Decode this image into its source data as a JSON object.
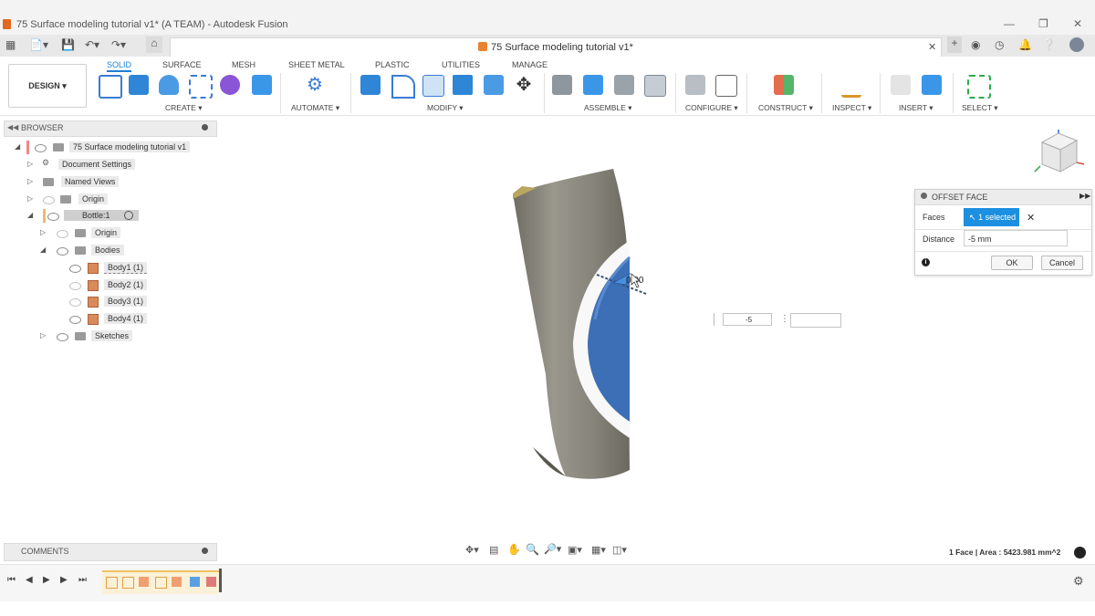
{
  "window": {
    "title": "75 Surface modeling tutorial v1* (A TEAM) - Autodesk Fusion"
  },
  "tab": {
    "doc_title": "75 Surface modeling tutorial v1*"
  },
  "workspace": {
    "label": "DESIGN"
  },
  "ribbon": {
    "tabs": [
      "SOLID",
      "SURFACE",
      "MESH",
      "SHEET METAL",
      "PLASTIC",
      "UTILITIES",
      "MANAGE"
    ],
    "active_tab": "SOLID",
    "groups": [
      "CREATE",
      "AUTOMATE",
      "MODIFY",
      "ASSEMBLE",
      "CONFIGURE",
      "CONSTRUCT",
      "INSPECT",
      "INSERT",
      "SELECT"
    ]
  },
  "browser": {
    "title": "BROWSER",
    "items": [
      {
        "label": "75 Surface modeling tutorial v1"
      },
      {
        "label": "Document Settings"
      },
      {
        "label": "Named Views"
      },
      {
        "label": "Origin"
      },
      {
        "label": "Bottle:1"
      },
      {
        "label": "Origin"
      },
      {
        "label": "Bodies"
      },
      {
        "label": "Body1 (1)"
      },
      {
        "label": "Body2 (1)"
      },
      {
        "label": "Body3 (1)"
      },
      {
        "label": "Body4 (1)"
      },
      {
        "label": "Sketches"
      }
    ]
  },
  "comments": {
    "title": "COMMENTS"
  },
  "dialog": {
    "title": "OFFSET FACE",
    "faces_label": "Faces",
    "faces_value": "1 selected",
    "distance_label": "Distance",
    "distance_value": "-5 mm",
    "ok": "OK",
    "cancel": "Cancel"
  },
  "viewport": {
    "manipulator_value": "0.00",
    "input_value": "-5"
  },
  "status": {
    "selection_info": "1 Face | Area : 5423.981 mm^2"
  },
  "colors": {
    "accent": "#1c7ed6",
    "selected_face": "#3c6fb5",
    "body": "#8d8a80",
    "dialog_chip": "#1c8fe0"
  }
}
